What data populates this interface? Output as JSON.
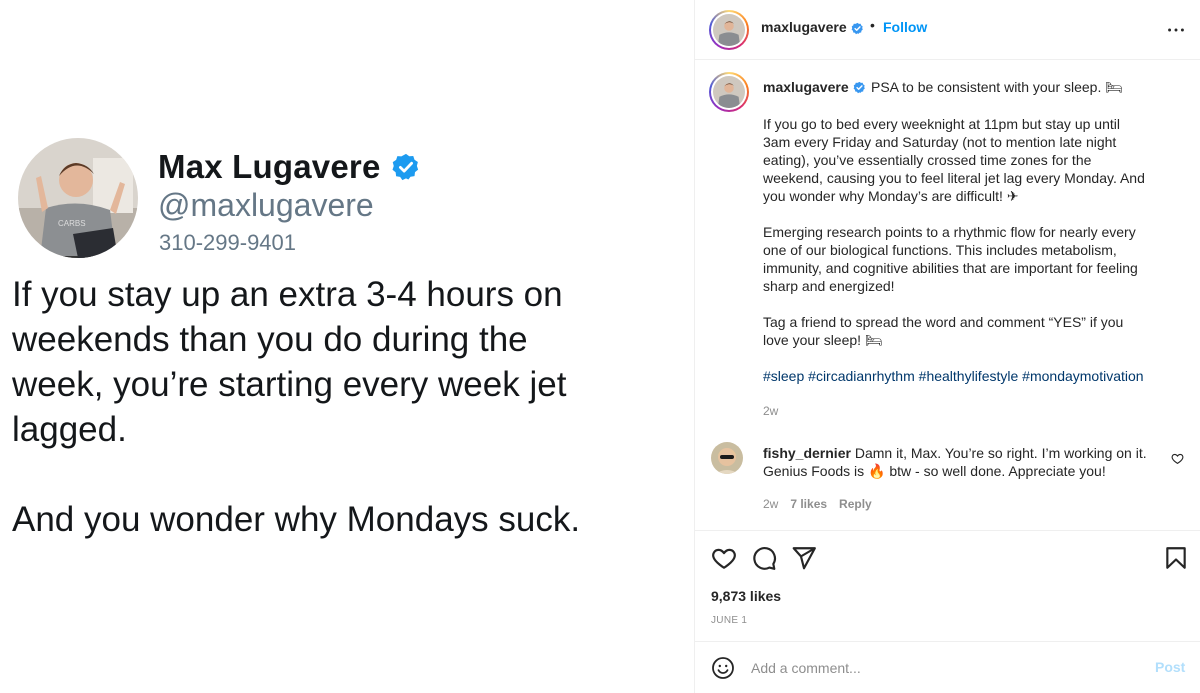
{
  "tweet": {
    "name": "Max Lugavere",
    "handle": "@maxlugavere",
    "phone": "310-299-9401",
    "paragraphs": [
      "If you stay up an extra 3-4 hours on\nweekends than you do during the\nweek, you’re starting every week jet\nlagged.",
      "And you wonder why Mondays suck."
    ],
    "shirt_text": "CARBS",
    "icons": {
      "verified": "verified-badge-icon"
    }
  },
  "post": {
    "username": "maxlugavere",
    "dot": "•",
    "follow_label": "Follow",
    "more_icon": "more-options-icon",
    "caption": {
      "username": "maxlugavere",
      "first_line": "PSA to be consistent with your sleep. 🛏",
      "paragraphs": [
        "If you go to bed every weeknight at 11pm but stay up until\n3am every Friday and Saturday (not to mention late night\neating), you’ve essentially crossed time zones for the\nweekend, causing you to feel literal jet lag every Monday. And\nyou wonder why Monday’s are difficult! ✈",
        "Emerging research points to a rhythmic flow for nearly every\none of our biological functions. This includes metabolism,\nimmunity, and cognitive abilities that are important for feeling\nsharp and energized!",
        "Tag a friend to spread the word and comment “YES” if you\nlove your sleep! 🛏"
      ],
      "hashtags": [
        "#sleep",
        "#circadianrhythm",
        "#healthylifestyle",
        "#mondaymotivation"
      ],
      "time": "2w"
    },
    "comment": {
      "username": "fishy_dernier",
      "text": "Damn it, Max. You’re so right. I’m working on it. Genius Foods is 🔥 btw - so well done. Appreciate you!",
      "time": "2w",
      "likes": "7 likes",
      "reply_label": "Reply"
    },
    "likes": "9,873 likes",
    "date": "JUNE 1",
    "add_comment_placeholder": "Add a comment...",
    "post_label": "Post",
    "colors": {
      "accent": "#0095f6",
      "hashtag": "#00376b",
      "muted": "#8e8e8e",
      "post_disabled": "#b2dffc"
    }
  }
}
